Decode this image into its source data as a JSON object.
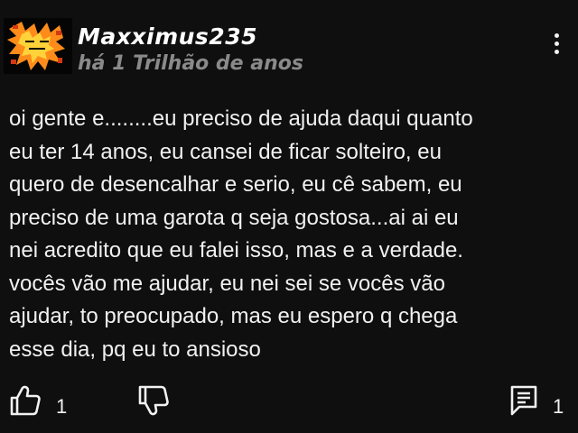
{
  "comment": {
    "author": "Maxximus235",
    "timestamp": "há 1 Trilhão de anos",
    "avatar_icon": "flame-avatar-icon",
    "menu_icon": "vertical-dots-icon",
    "body_lines": [
      "oi gente e........eu preciso de ajuda daqui quanto",
      "eu ter 14 anos, eu cansei de ficar solteiro, eu",
      "quero de desencalhar e serio, eu cê sabem, eu",
      "preciso de uma garota q seja gostosa...ai ai eu",
      "nei acredito que eu falei isso, mas e a verdade.",
      "vocês vão me ajudar, eu nei sei se vocês vão",
      "ajudar, to preocupado, mas eu espero q chega",
      "esse dia, pq eu to ansioso"
    ],
    "actions": {
      "like_icon": "thumbs-up-icon",
      "like_count": "1",
      "dislike_icon": "thumbs-down-icon",
      "reply_icon": "reply-comment-icon",
      "reply_count": "1"
    },
    "colors": {
      "background": "#0f0f0f",
      "text": "#f1f1f1",
      "timestamp": "#8a8a8a",
      "avatar_accent": "#ff8c1a"
    }
  }
}
